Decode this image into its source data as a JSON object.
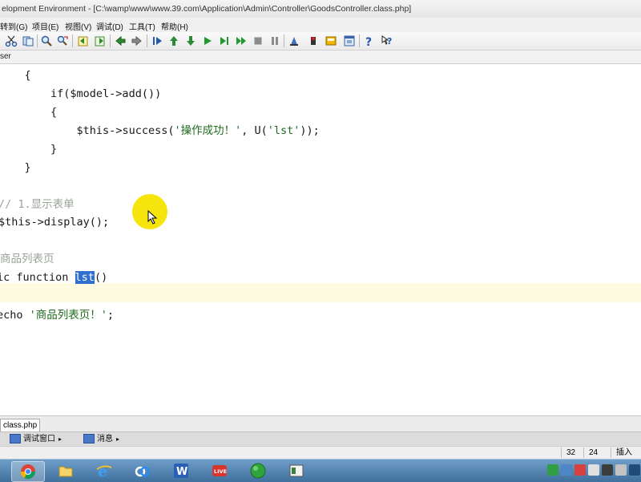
{
  "window": {
    "title": "elopment Environment - [C:\\wamp\\www\\www.39.com\\Application\\Admin\\Controller\\GoodsController.class.php]"
  },
  "menu": [
    "转到(G)",
    "项目(E)",
    "视图(V)",
    "调试(D)",
    "工具(T)",
    "帮助(H)"
  ],
  "toolbar": {
    "icons": [
      "cut-icon",
      "copy-icon",
      "search-icon",
      "replace-icon",
      "history-back-icon",
      "history-forward-icon",
      "bookmark-back-icon",
      "bookmark-forward-icon",
      "step-in-icon",
      "up-icon",
      "down-icon",
      "run-icon",
      "run-to-cursor-icon",
      "continue-icon",
      "stop-icon",
      "pause-icon",
      "debug-icon",
      "breakpoint-icon",
      "watch-icon",
      "window-icon",
      "help-icon",
      "context-help-icon"
    ]
  },
  "panel_header": "ser",
  "editor": {
    "lines": [
      {
        "indent": "    ",
        "parts": [
          {
            "t": "{",
            "c": ""
          }
        ]
      },
      {
        "indent": "        ",
        "parts": [
          {
            "t": "if($model->add())",
            "c": ""
          }
        ]
      },
      {
        "indent": "        ",
        "parts": [
          {
            "t": "{",
            "c": ""
          }
        ]
      },
      {
        "indent": "            ",
        "parts": [
          {
            "t": "$this->success(",
            "c": ""
          },
          {
            "t": "'操作成功！'",
            "c": "str"
          },
          {
            "t": ", U(",
            "c": ""
          },
          {
            "t": "'lst'",
            "c": "str"
          },
          {
            "t": "));",
            "c": ""
          }
        ]
      },
      {
        "indent": "        ",
        "parts": [
          {
            "t": "}",
            "c": ""
          }
        ]
      },
      {
        "indent": "    ",
        "parts": [
          {
            "t": "}",
            "c": ""
          }
        ]
      },
      {
        "indent": "",
        "parts": [
          {
            "t": "}",
            "c": ""
          }
        ]
      },
      {
        "indent": "",
        "parts": [
          {
            "t": "// 1.显示表单",
            "c": "cmt"
          }
        ]
      },
      {
        "indent": "",
        "parts": [
          {
            "t": "$this->display();",
            "c": ""
          }
        ]
      },
      {
        "indent": "",
        "parts": []
      },
      {
        "indent": "",
        "parts": [
          {
            "t": "商品列表页",
            "c": "cmt"
          }
        ]
      },
      {
        "indent": "",
        "parts": [
          {
            "t": "ic function ",
            "c": ""
          },
          {
            "t": "lst",
            "c": "sel"
          },
          {
            "t": "()",
            "c": ""
          }
        ]
      },
      {
        "indent": "",
        "parts": []
      },
      {
        "indent": "",
        "parts": [
          {
            "t": "echo ",
            "c": ""
          },
          {
            "t": "'商品列表页！'",
            "c": "str"
          },
          {
            "t": ";",
            "c": ""
          }
        ]
      }
    ]
  },
  "file_tab": "class.php",
  "bottom_tabs": [
    {
      "label": "调试窗口",
      "arrow": "▸"
    },
    {
      "label": "消息",
      "arrow": "▸"
    }
  ],
  "status": {
    "line": "32",
    "col": "24",
    "mode": "插入"
  },
  "taskbar": {
    "apps": [
      "chrome-icon",
      "explorer-folder-icon",
      "ie-icon",
      "baidu-netdisk-icon",
      "word-icon",
      "live-video-icon",
      "green-ball-icon",
      "app-window-icon"
    ],
    "tray": [
      "sogou-ime-icon",
      "flag-icon",
      "notification-icon",
      "network-icon",
      "volume-icon",
      "keyboard-icon",
      "clock-icon"
    ]
  },
  "colors": {
    "string": "#1e6b1e",
    "comment": "#9aa39a",
    "selection": "#2f6fd0",
    "cursor_highlight": "#f5e400",
    "taskbar": "#4f7fad"
  }
}
